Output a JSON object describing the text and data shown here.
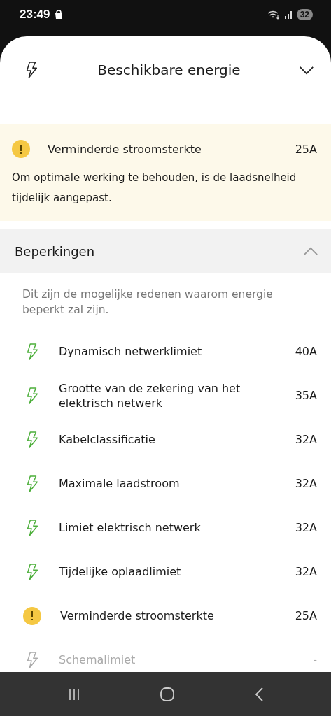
{
  "status_bar": {
    "time": "23:49",
    "battery": "32"
  },
  "header": {
    "title": "Beschikbare energie",
    "expanded": true
  },
  "alert": {
    "title": "Verminderde stroomsterkte",
    "value": "25A",
    "message": "Om optimale werking te behouden, is de laadsnelheid tijdelijk aangepast."
  },
  "section": {
    "title": "Beperkingen",
    "expanded": true,
    "description": "Dit zijn de mogelijke redenen waarom energie beperkt zal zijn."
  },
  "limits": [
    {
      "kind": "bolt",
      "label": "Dynamisch netwerklimiet",
      "value": "40A",
      "disabled": false
    },
    {
      "kind": "bolt",
      "label": "Grootte van de zekering van het elektrisch netwerk",
      "value": "35A",
      "disabled": false
    },
    {
      "kind": "bolt",
      "label": "Kabelclassificatie",
      "value": "32A",
      "disabled": false
    },
    {
      "kind": "bolt",
      "label": "Maximale laadstroom",
      "value": "32A",
      "disabled": false
    },
    {
      "kind": "bolt",
      "label": "Limiet elektrisch netwerk",
      "value": "32A",
      "disabled": false
    },
    {
      "kind": "bolt",
      "label": "Tijdelijke oplaadlimiet",
      "value": "32A",
      "disabled": false
    },
    {
      "kind": "warning",
      "label": "Verminderde stroomsterkte",
      "value": "25A",
      "disabled": false
    },
    {
      "kind": "bolt",
      "label": "Schemalimiet",
      "value": "-",
      "disabled": true
    }
  ]
}
